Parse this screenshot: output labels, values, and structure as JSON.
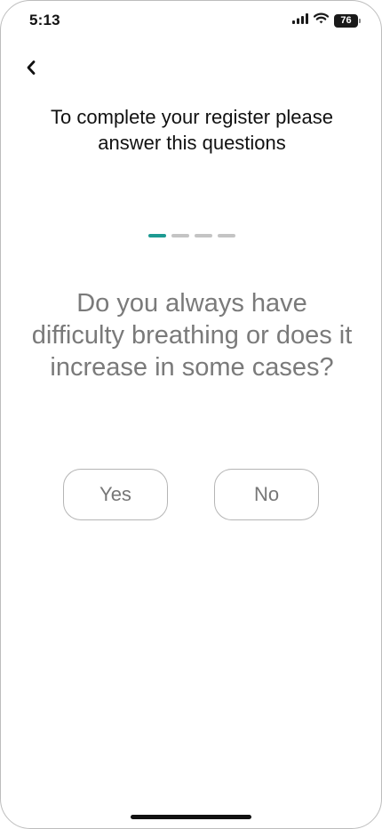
{
  "status_bar": {
    "time": "5:13",
    "battery_level": "76",
    "icons": [
      "signal-icon",
      "wifi-icon",
      "battery-icon"
    ]
  },
  "header": {
    "back_icon": "chevron-left-icon",
    "title": "To complete your register please answer this questions"
  },
  "progress": {
    "current_step": 1,
    "total_steps": 4,
    "active_color": "#1d9a92",
    "inactive_color": "#c4c4c4"
  },
  "question": {
    "text": "Do you always have difficulty breathing or does it increase in some cases?"
  },
  "answers": {
    "yes_label": "Yes",
    "no_label": "No"
  }
}
